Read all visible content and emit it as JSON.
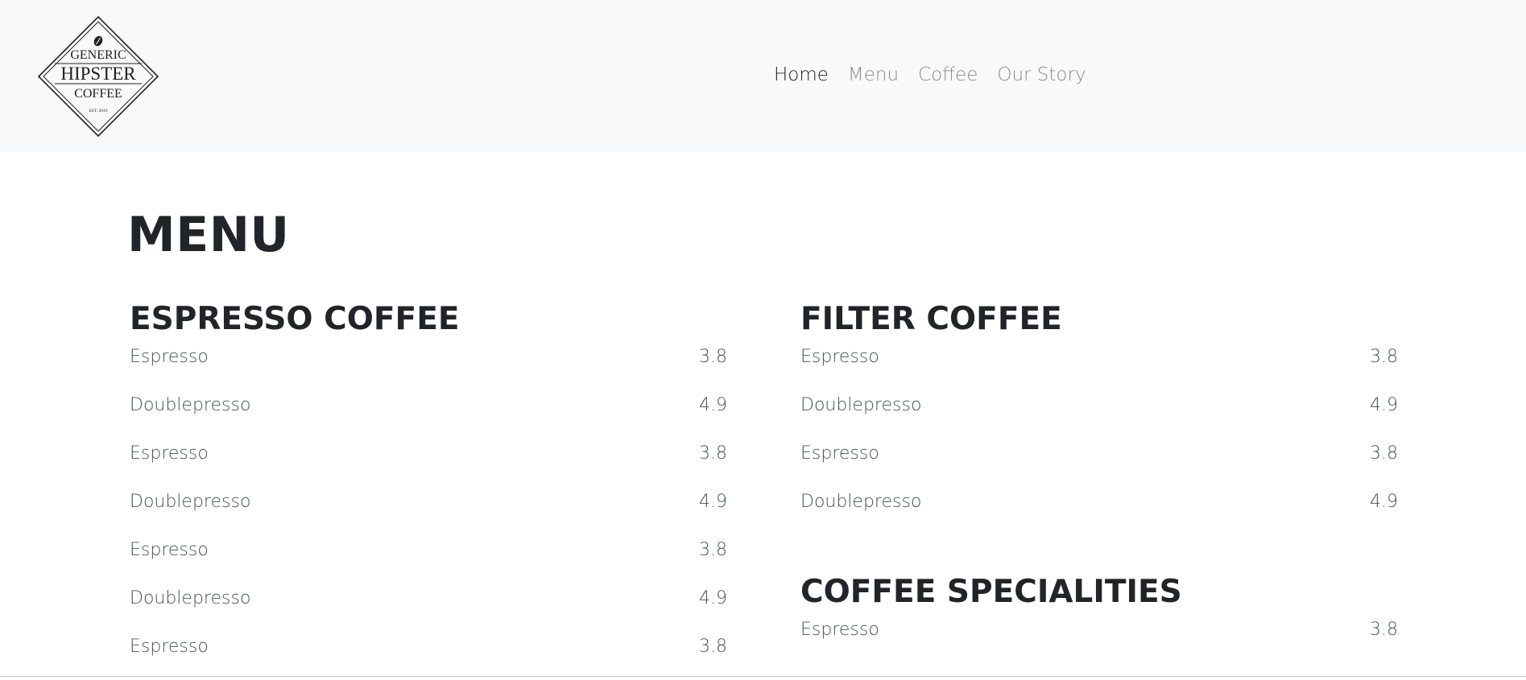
{
  "logo": {
    "line1": "GENERIC",
    "line2": "HIPSTER",
    "line3": "COFFEE",
    "line4": "EST. 2016"
  },
  "nav": {
    "items": [
      {
        "label": "Home",
        "active": true
      },
      {
        "label": "Menu",
        "active": false
      },
      {
        "label": "Coffee",
        "active": false
      },
      {
        "label": "Our Story",
        "active": false
      }
    ]
  },
  "main": {
    "title": "MENU",
    "sections": {
      "espresso": {
        "title": "ESPRESSO COFFEE",
        "items": [
          {
            "name": "Espresso",
            "price": "3.8"
          },
          {
            "name": "Doublepresso",
            "price": "4.9"
          },
          {
            "name": "Espresso",
            "price": "3.8"
          },
          {
            "name": "Doublepresso",
            "price": "4.9"
          },
          {
            "name": "Espresso",
            "price": "3.8"
          },
          {
            "name": "Doublepresso",
            "price": "4.9"
          },
          {
            "name": "Espresso",
            "price": "3.8"
          }
        ]
      },
      "filter": {
        "title": "FILTER COFFEE",
        "items": [
          {
            "name": "Espresso",
            "price": "3.8"
          },
          {
            "name": "Doublepresso",
            "price": "4.9"
          },
          {
            "name": "Espresso",
            "price": "3.8"
          },
          {
            "name": "Doublepresso",
            "price": "4.9"
          }
        ]
      },
      "specialities": {
        "title": "COFFEE SPECIALITIES",
        "items": [
          {
            "name": "Espresso",
            "price": "3.8"
          }
        ]
      }
    }
  }
}
